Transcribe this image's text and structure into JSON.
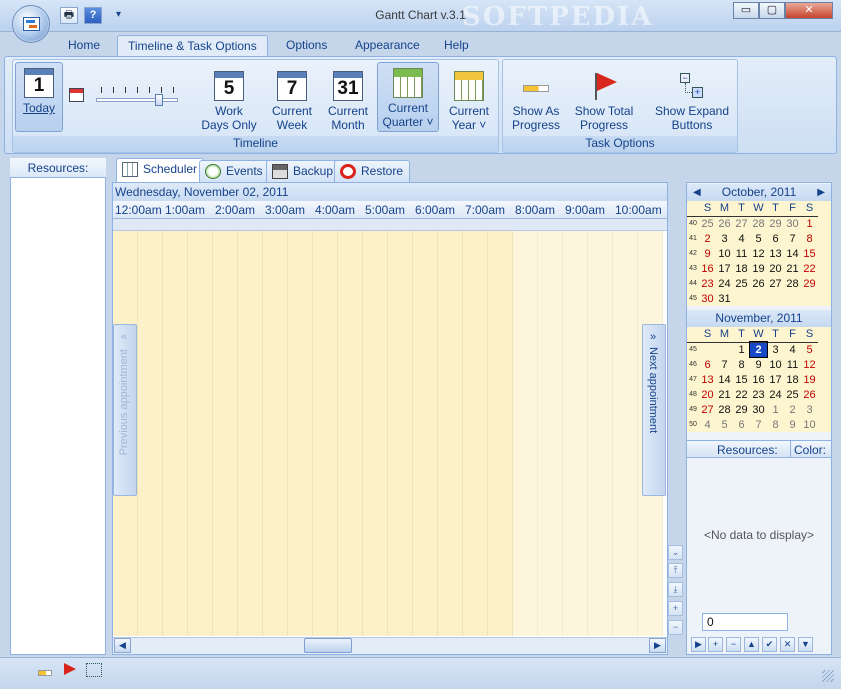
{
  "window": {
    "title": "Gantt Chart v.3.1",
    "watermark": "SOFTPEDIA",
    "controls": {
      "minimize": "▭",
      "maximize": "▢",
      "close": "✕"
    }
  },
  "quick_access": {
    "print": "🖶",
    "help": "?",
    "customize": "▾"
  },
  "ribbon": {
    "tabs": [
      {
        "label": "Home"
      },
      {
        "label": "Timeline & Task Options"
      },
      {
        "label": "Options"
      },
      {
        "label": "Appearance"
      },
      {
        "label": "Help"
      }
    ],
    "timeline": {
      "group_title": "Timeline",
      "today": {
        "label": "Today",
        "icon_num": "1"
      },
      "work_days": {
        "label1": "Work",
        "label2": "Days Only",
        "icon_num": "5"
      },
      "current_week": {
        "label1": "Current",
        "label2": "Week",
        "icon_num": "7"
      },
      "current_month": {
        "label1": "Current",
        "label2": "Month",
        "icon_num": "31"
      },
      "current_quarter": {
        "label1": "Current",
        "label2": "Quarter ˅"
      },
      "current_year": {
        "label1": "Current",
        "label2": "Year ˅"
      },
      "zoom_level": 0.75
    },
    "task_options": {
      "group_title": "Task Options",
      "show_as_progress": {
        "label1": "Show As",
        "label2": "Progress"
      },
      "show_total_progress": {
        "label1": "Show Total",
        "label2": "Progress"
      },
      "show_expand_buttons": {
        "label1": "Show Expand",
        "label2": "Buttons"
      }
    }
  },
  "left_pane": {
    "header": "Resources:"
  },
  "main_tabs": [
    {
      "label": "Scheduler"
    },
    {
      "label": "Events"
    },
    {
      "label": "Backup"
    },
    {
      "label": "Restore"
    }
  ],
  "scheduler": {
    "date": "Wednesday, November 02, 2011",
    "hours": [
      "12:00am",
      "1:00am",
      "2:00am",
      "3:00am",
      "4:00am",
      "5:00am",
      "6:00am",
      "7:00am",
      "8:00am",
      "9:00am",
      "10:00am"
    ],
    "previous_appointment": "Previous appointment",
    "next_appointment": "Next appointment",
    "prev_arrow": "«",
    "next_arrow": "»"
  },
  "calendar": {
    "prev_arrow": "◀",
    "next_arrow": "▶",
    "weekdays": [
      "S",
      "M",
      "T",
      "W",
      "T",
      "F",
      "S"
    ],
    "months": [
      {
        "title": "October, 2011",
        "weeks": [
          {
            "wk": "40",
            "days": [
              "25",
              "26",
              "27",
              "28",
              "29",
              "30",
              "1"
            ]
          },
          {
            "wk": "41",
            "days": [
              "2",
              "3",
              "4",
              "5",
              "6",
              "7",
              "8"
            ]
          },
          {
            "wk": "42",
            "days": [
              "9",
              "10",
              "11",
              "12",
              "13",
              "14",
              "15"
            ]
          },
          {
            "wk": "43",
            "days": [
              "16",
              "17",
              "18",
              "19",
              "20",
              "21",
              "22"
            ]
          },
          {
            "wk": "44",
            "days": [
              "23",
              "24",
              "25",
              "26",
              "27",
              "28",
              "29"
            ]
          },
          {
            "wk": "45",
            "days": [
              "30",
              "31",
              "",
              "",
              "",
              "",
              ""
            ]
          }
        ]
      },
      {
        "title": "November, 2011",
        "weeks": [
          {
            "wk": "45",
            "days": [
              "",
              "",
              "1",
              "2",
              "3",
              "4",
              "5"
            ]
          },
          {
            "wk": "46",
            "days": [
              "6",
              "7",
              "8",
              "9",
              "10",
              "11",
              "12"
            ]
          },
          {
            "wk": "47",
            "days": [
              "13",
              "14",
              "15",
              "16",
              "17",
              "18",
              "19"
            ]
          },
          {
            "wk": "48",
            "days": [
              "20",
              "21",
              "22",
              "23",
              "24",
              "25",
              "26"
            ]
          },
          {
            "wk": "49",
            "days": [
              "27",
              "28",
              "29",
              "30",
              "1",
              "2",
              "3"
            ]
          },
          {
            "wk": "50",
            "days": [
              "4",
              "5",
              "6",
              "7",
              "8",
              "9",
              "10"
            ]
          }
        ]
      }
    ],
    "selected_day": "2"
  },
  "resources_grid": {
    "col_resources": "Resources:",
    "col_color": "Color:",
    "empty": "<No data to display>",
    "nav_value": "0"
  },
  "colors": {
    "accent": "#15428b",
    "today": "#1849c4",
    "weekend": "#c00000",
    "timeline_bg": "#fdf1c9"
  }
}
